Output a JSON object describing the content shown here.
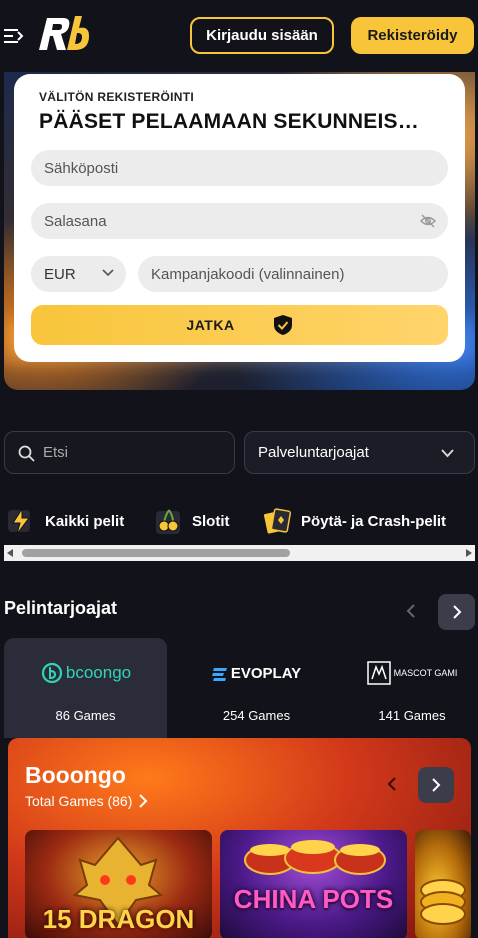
{
  "header": {
    "login_label": "Kirjaudu sisään",
    "register_label": "Rekisteröidy"
  },
  "registration": {
    "eyebrow": "VÄLITÖN REKISTERÖINTI",
    "title": "PÄÄSET PELAAMAAN SEKUNNEIS…",
    "email_placeholder": "Sähköposti",
    "password_placeholder": "Salasana",
    "currency": "EUR",
    "promo_placeholder": "Kampanjakoodi (valinnainen)",
    "continue_label": "JATKA"
  },
  "search": {
    "placeholder": "Etsi",
    "provider_select": "Palveluntarjoajat"
  },
  "categories": [
    {
      "label": "Kaikki pelit",
      "icon": "lightning-icon"
    },
    {
      "label": "Slotit",
      "icon": "cherry-icon"
    },
    {
      "label": "Pöytä- ja Crash-pelit",
      "icon": "cards-icon"
    }
  ],
  "providers": {
    "heading": "Pelintarjoajat",
    "items": [
      {
        "name": "bcoongo",
        "count": "86 Games"
      },
      {
        "name": "EVOPLAY",
        "count": "254 Games"
      },
      {
        "name": "MASCOT GAMI",
        "count": "141 Games"
      }
    ]
  },
  "featured": {
    "title": "Booongo",
    "total": "Total Games (86)",
    "games": [
      {
        "title_line": "15 DRAGON"
      },
      {
        "title_line": "CHINA POTS"
      },
      {
        "title_line": ""
      }
    ]
  },
  "colors": {
    "accent": "#f8c53a",
    "background": "#12121a",
    "card": "#2b2c3a"
  }
}
